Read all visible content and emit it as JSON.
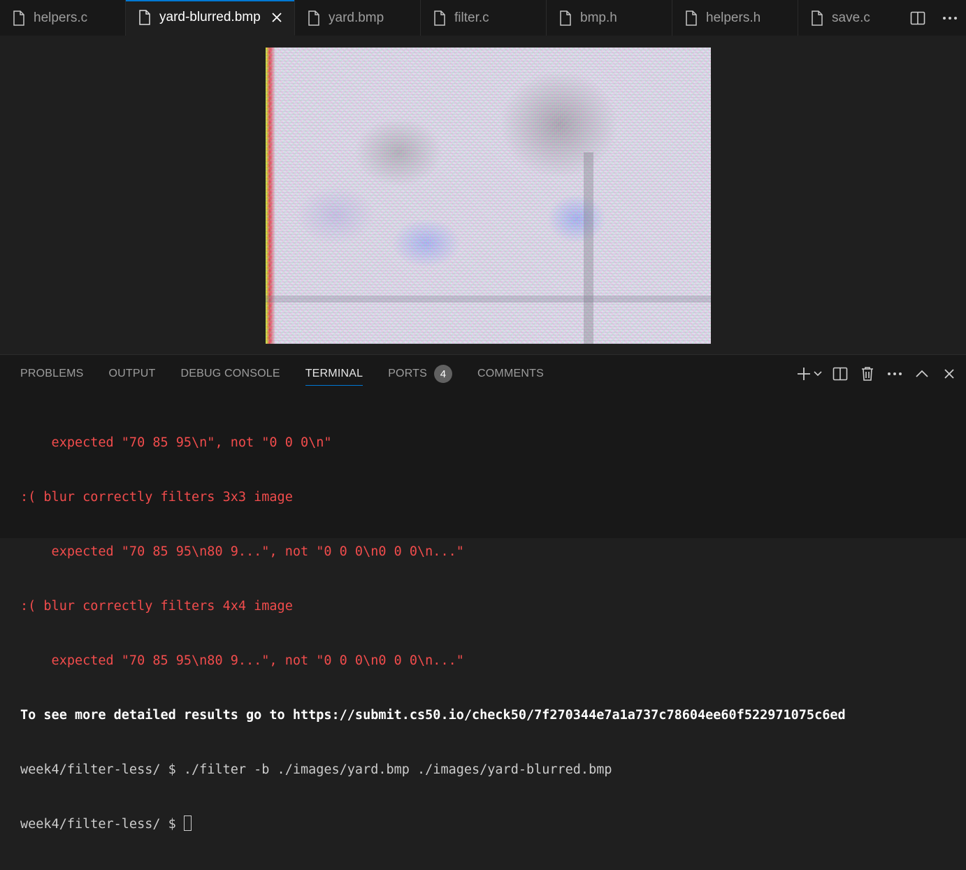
{
  "tabs": [
    {
      "label": "helpers.c",
      "active": false
    },
    {
      "label": "yard-blurred.bmp",
      "active": true
    },
    {
      "label": "yard.bmp",
      "active": false
    },
    {
      "label": "filter.c",
      "active": false
    },
    {
      "label": "bmp.h",
      "active": false
    },
    {
      "label": "helpers.h",
      "active": false
    },
    {
      "label": "save.c",
      "active": false
    }
  ],
  "tab_actions": {
    "split_icon": "split-editor-icon",
    "more_icon": "more-actions-icon"
  },
  "panel": {
    "tabs": [
      {
        "label": "PROBLEMS"
      },
      {
        "label": "OUTPUT"
      },
      {
        "label": "DEBUG CONSOLE"
      },
      {
        "label": "TERMINAL",
        "active": true
      },
      {
        "label": "PORTS",
        "badge": "4"
      },
      {
        "label": "COMMENTS"
      }
    ],
    "actions": [
      "new-terminal-icon",
      "dropdown-icon",
      "split-terminal-icon",
      "trash-icon",
      "more-icon",
      "maximize-panel-icon",
      "close-panel-icon"
    ]
  },
  "terminal": {
    "lines": [
      "    expected \"70 85 95\\n\", not \"0 0 0\\n\"",
      ":( blur correctly filters 3x3 image",
      "    expected \"70 85 95\\n80 9...\", not \"0 0 0\\n0 0 0\\n...\"",
      ":( blur correctly filters 4x4 image",
      "    expected \"70 85 95\\n80 9...\", not \"0 0 0\\n0 0 0\\n...\"",
      "To see more detailed results go to https://submit.cs50.io/check50/7f270344e7a1a737c78604ee60f522971075c6ed",
      "week4/filter-less/ $ ./filter -b ./images/yard.bmp ./images/yard-blurred.bmp",
      "week4/filter-less/ $ "
    ]
  },
  "colors": {
    "accent": "#0078d4",
    "error": "#f14c4c",
    "background": "#1f1f1f"
  }
}
